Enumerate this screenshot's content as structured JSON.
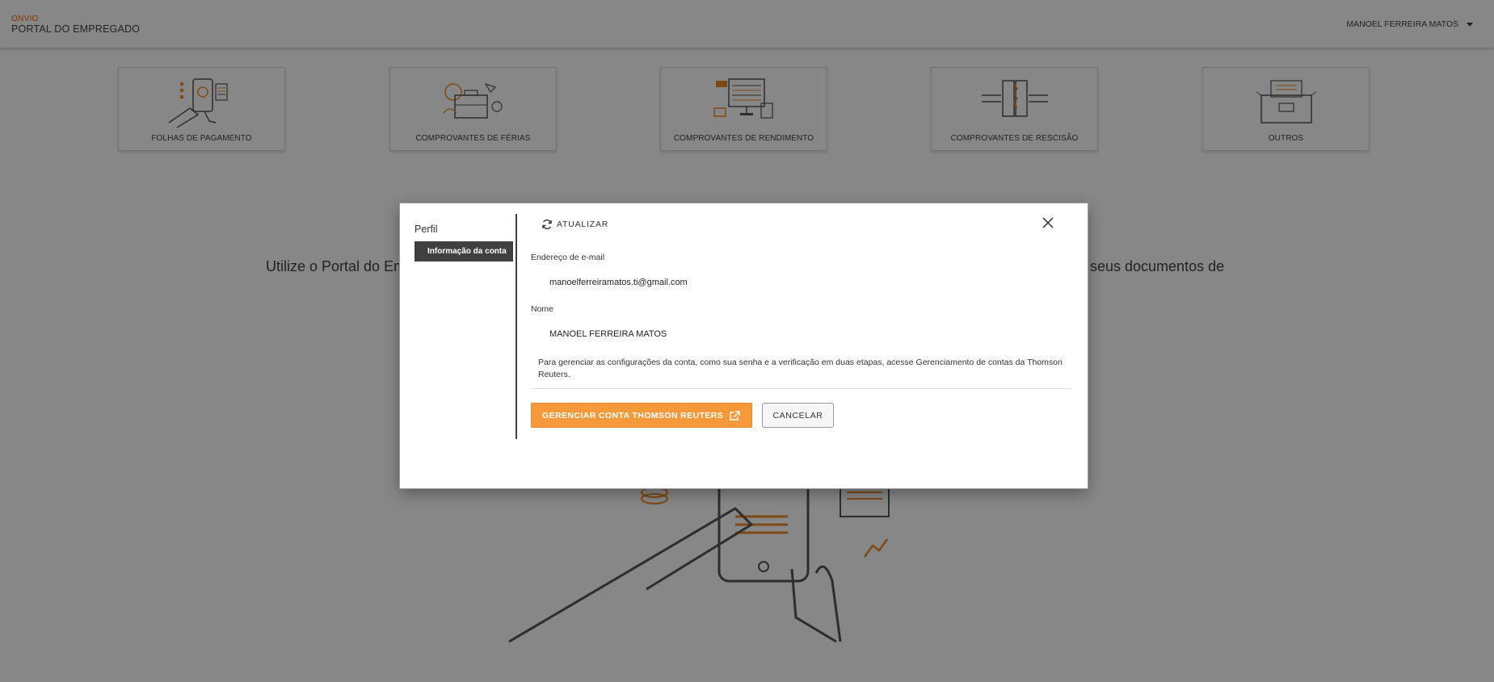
{
  "header": {
    "brand_small": "ONVIO",
    "brand_title": "PORTAL DO EMPREGADO",
    "user_name": "MANOEL FERREIRA MATOS"
  },
  "cards": [
    {
      "label": "FOLHAS DE PAGAMENTO",
      "icon": "payroll-icon"
    },
    {
      "label": "COMPROVANTES DE FÉRIAS",
      "icon": "vacation-icon"
    },
    {
      "label": "COMPROVANTES DE RENDIMENTO",
      "icon": "income-icon"
    },
    {
      "label": "COMPROVANTES DE RESCISÃO",
      "icon": "termination-icon"
    },
    {
      "label": "OUTROS",
      "icon": "others-icon"
    }
  ],
  "welcome": {
    "left_visible": "Utilize o Portal do Em",
    "right_visible": "seus documentos de"
  },
  "modal": {
    "sidebar_title": "Perfil",
    "sidebar_item": "Informação da conta",
    "refresh_label": "ATUALIZAR",
    "email_label": "Endereço de e-mail",
    "email_value": "manoelferreiramatos.ti@gmail.com",
    "name_label": "Nome",
    "name_value": "MANOEL FERREIRA MATOS",
    "info_text": "Para gerenciar as configurações da conta, como sua senha e a verificação em duas etapas, acesse Gerenciamento de contas da Thomson Reuters.",
    "manage_button": "GERENCIAR CONTA THOMSON REUTERS",
    "cancel_button": "CANCELAR"
  },
  "colors": {
    "accent": "#f5993a",
    "brand_orange": "#fa6400",
    "dark": "#404040",
    "overlay": "rgba(0,0,0,0.47)"
  }
}
